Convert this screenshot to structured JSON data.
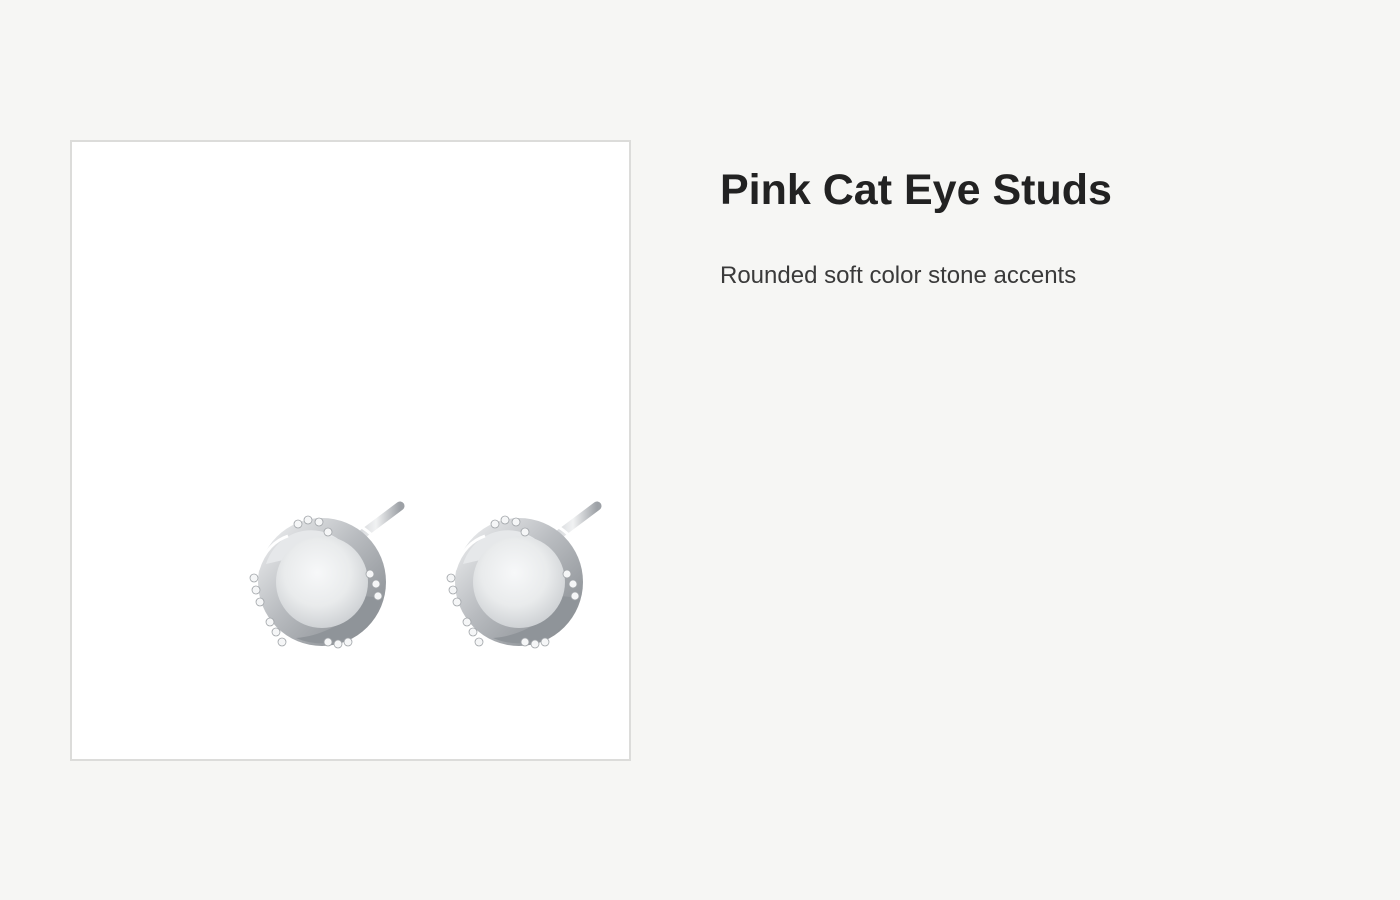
{
  "product": {
    "title": "Pink Cat Eye Studs",
    "subtitle": "Rounded soft color stone accents",
    "image_icon": "stud-earrings-icon"
  },
  "colors": {
    "background": "#f6f6f4",
    "frame_border": "#dcdcda",
    "metal": "#b9bcc0",
    "stone": "#eceeef"
  }
}
